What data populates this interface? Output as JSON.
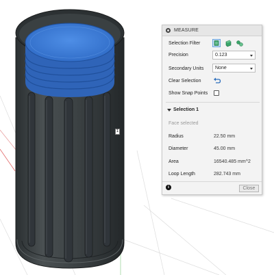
{
  "viewport": {
    "model": "cylindrical-container",
    "edge_tag": "1",
    "colors": {
      "body": "#3f4446",
      "body_dark": "#25292b",
      "selected_face": "#3d7ad6",
      "axis_red": "#e26a6a",
      "axis_green": "#6ec86e",
      "grid": "#d9d9d9"
    }
  },
  "panel": {
    "title": "MEASURE",
    "selection_filter": {
      "label": "Selection Filter",
      "icons": [
        "select-body-icon",
        "select-face-icon",
        "select-edge-icon"
      ]
    },
    "precision": {
      "label": "Precision",
      "value": "0.123"
    },
    "secondary_units": {
      "label": "Secondary Units",
      "value": "None"
    },
    "clear_selection": {
      "label": "Clear Selection",
      "icon": "undo-arrow-icon"
    },
    "show_snap_points": {
      "label": "Show Snap Points",
      "checked": false
    },
    "selection": {
      "title": "Selection 1",
      "type": "Face selected",
      "radius": {
        "label": "Radius",
        "value": "22.50 mm"
      },
      "diameter": {
        "label": "Diameter",
        "value": "45.00 mm"
      },
      "area": {
        "label": "Area",
        "value": "16540.485 mm^2"
      },
      "loop_length": {
        "label": "Loop Length",
        "value": "282.743 mm"
      }
    },
    "close_label": "Close"
  },
  "colors": {
    "accent": "#4a90d9",
    "panel_bg": "#f3f3f3"
  }
}
